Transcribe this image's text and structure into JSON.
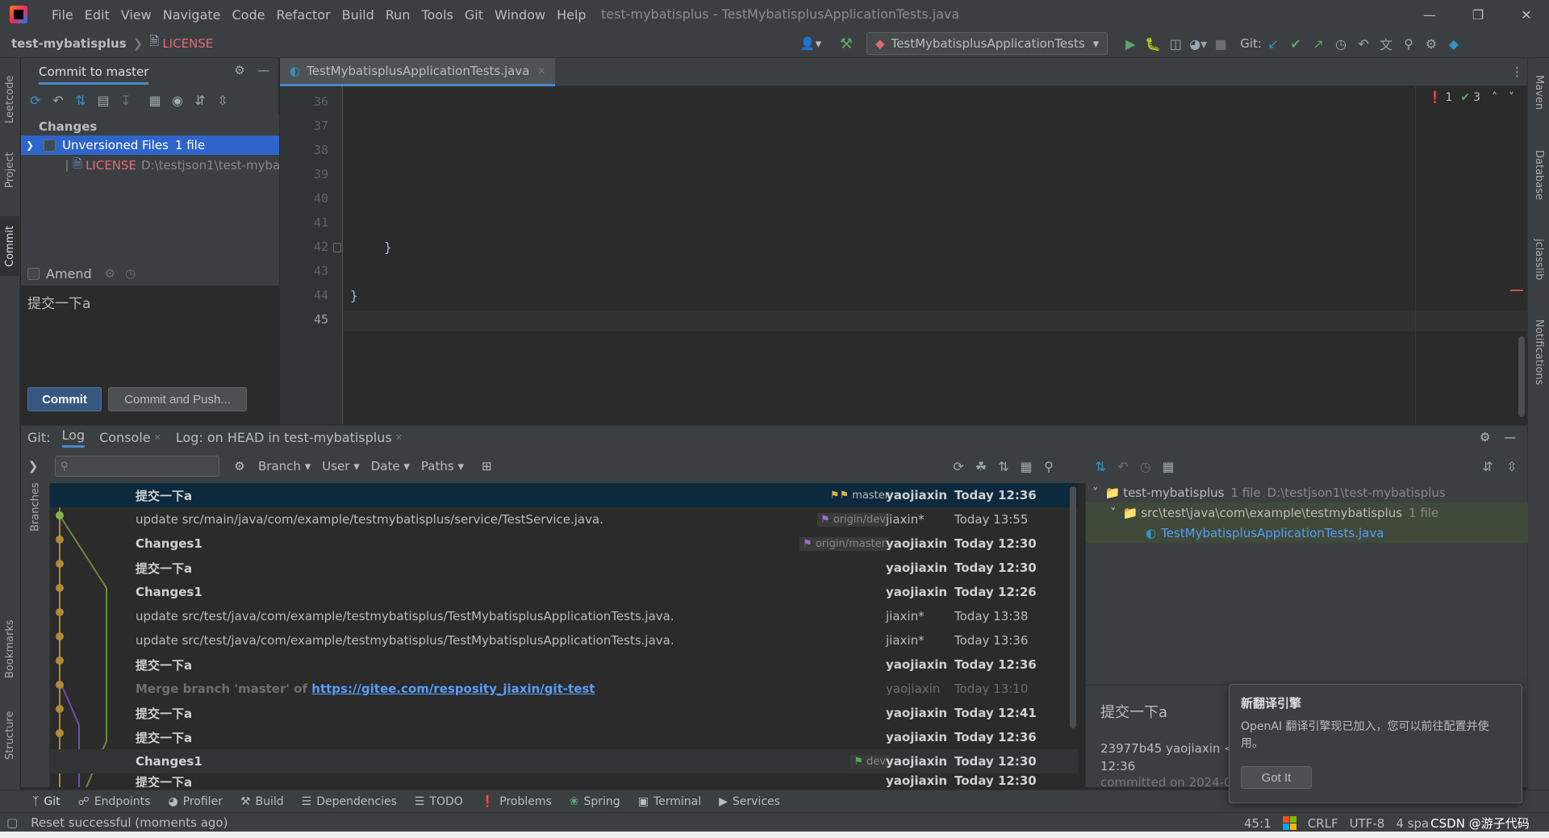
{
  "menubar": {
    "items": [
      "File",
      "Edit",
      "View",
      "Navigate",
      "Code",
      "Refactor",
      "Build",
      "Run",
      "Tools",
      "Git",
      "Window",
      "Help"
    ],
    "title": "test-mybatisplus - TestMybatisplusApplicationTests.java"
  },
  "navbar": {
    "project": "test-mybatisplus",
    "file": "LICENSE",
    "run_config": "TestMybatisplusApplicationTests",
    "git_label": "Git:"
  },
  "left_stripe": [
    "Leetcode",
    "Project",
    "Commit",
    "Bookmarks",
    "Structure"
  ],
  "right_stripe": [
    "Maven",
    "Database",
    "jclasslib",
    "Notifications"
  ],
  "commit_panel": {
    "title": "Commit to master",
    "changes_label": "Changes",
    "group_label": "Unversioned Files",
    "group_count": "1 file",
    "file_name": "LICENSE",
    "file_path": "D:\\testjson1\\test-mybatisplus",
    "amend_label": "Amend",
    "message": "提交一下a",
    "commit_button": "Commit",
    "commit_push_button": "Commit and Push..."
  },
  "editor": {
    "tab_label": "TestMybatisplusApplicationTests.java",
    "line_numbers": [
      "36",
      "37",
      "38",
      "39",
      "40",
      "41",
      "42",
      "43",
      "44",
      "45"
    ],
    "lines": {
      "l42": "}",
      "l44": "}"
    },
    "errors": "1",
    "warnings": "3"
  },
  "git_panel": {
    "label": "Git:",
    "tabs": [
      "Log",
      "Console",
      "Log: on HEAD in test-mybatisplus"
    ],
    "search_placeholder": "",
    "filters": [
      "Branch",
      "User",
      "Date",
      "Paths"
    ],
    "branches_label": "Branches",
    "commits": [
      {
        "message": "提交一下a",
        "ref": "master",
        "author": "yaojiaxin",
        "date": "Today 12:36",
        "bold": true
      },
      {
        "message": "update src/main/java/com/example/testmybatisplus/service/TestService.java.",
        "ref": "origin/dev",
        "author": "jiaxin*",
        "date": "Today 13:55",
        "bold": false
      },
      {
        "message": "Changes1",
        "ref": "origin/master",
        "author": "yaojiaxin",
        "date": "Today 12:30",
        "bold": true
      },
      {
        "message": "提交一下a",
        "ref": "",
        "author": "yaojiaxin",
        "date": "Today 12:30",
        "bold": true
      },
      {
        "message": "Changes1",
        "ref": "",
        "author": "yaojiaxin",
        "date": "Today 12:26",
        "bold": true
      },
      {
        "message": "update src/test/java/com/example/testmybatisplus/TestMybatisplusApplicationTests.java.",
        "ref": "",
        "author": "jiaxin*",
        "date": "Today 13:38",
        "bold": false
      },
      {
        "message": "update src/test/java/com/example/testmybatisplus/TestMybatisplusApplicationTests.java.",
        "ref": "",
        "author": "jiaxin*",
        "date": "Today 13:36",
        "bold": false
      },
      {
        "message": "提交一下a",
        "ref": "",
        "author": "yaojiaxin",
        "date": "Today 12:36",
        "bold": true
      },
      {
        "message": "Merge branch 'master' of",
        "link": "https://gitee.com/resposity_jiaxin/git-test",
        "ref": "",
        "author": "yaojiaxin",
        "date": "Today 13:10",
        "bold": false
      },
      {
        "message": "提交一下a",
        "ref": "",
        "author": "yaojiaxin",
        "date": "Today 12:41",
        "bold": true
      },
      {
        "message": "提交一下a",
        "ref": "",
        "author": "yaojiaxin",
        "date": "Today 12:36",
        "bold": true
      },
      {
        "message": "Changes1",
        "ref": "dev",
        "author": "yaojiaxin",
        "date": "Today 12:30",
        "bold": true
      },
      {
        "message": "提交一下a",
        "ref": "",
        "author": "yaojiaxin",
        "date": "Today 12:30",
        "bold": true
      }
    ],
    "details": {
      "root": "test-mybatisplus",
      "root_count": "1 file",
      "root_path": "D:\\testjson1\\test-mybatisplus",
      "folder": "src\\test\\java\\com\\example\\testmybatisplus",
      "folder_count": "1 file",
      "file": "TestMybatisplusApplicationTests.java",
      "commit_msg": "提交一下a",
      "hash_line": "23977b45 yaojiaxin <2",
      "time": "12:36",
      "committed": "committed on 2024-0"
    }
  },
  "bottom_tools": [
    "Git",
    "Endpoints",
    "Profiler",
    "Build",
    "Dependencies",
    "TODO",
    "Problems",
    "Spring",
    "Terminal",
    "Services"
  ],
  "statusbar": {
    "message": "Reset successful (moments ago)",
    "position": "45:1",
    "line_sep": "CRLF",
    "encoding": "UTF-8",
    "indent": "4 spa",
    "watermark": "CSDN @游子代码"
  },
  "popup": {
    "title": "新翻译引擎",
    "body": "OpenAI 翻译引擎现已加入，您可以前往配置并使用。",
    "button": "Got It"
  }
}
